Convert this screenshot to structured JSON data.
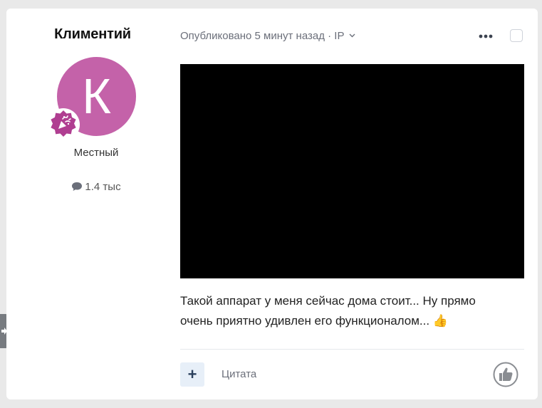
{
  "author": {
    "name": "Климентий",
    "avatar_letter": "К",
    "avatar_color": "#c462a9",
    "rank_title": "Местный",
    "post_count": "1.4 тыс",
    "badge_icon": "celebration-badge-icon"
  },
  "post": {
    "meta": "Опубликовано 5 минут назад · IP",
    "text_line1": "Такой аппарат у меня сейчас дома стоит... Ну прямо",
    "text_line2": "очень приятно удивлен его функционалом... 👍"
  },
  "actions": {
    "multiquote_label": "+",
    "quote_label": "Цитата"
  },
  "colors": {
    "accent": "#2a3f5c",
    "badge": "#b03e91"
  }
}
